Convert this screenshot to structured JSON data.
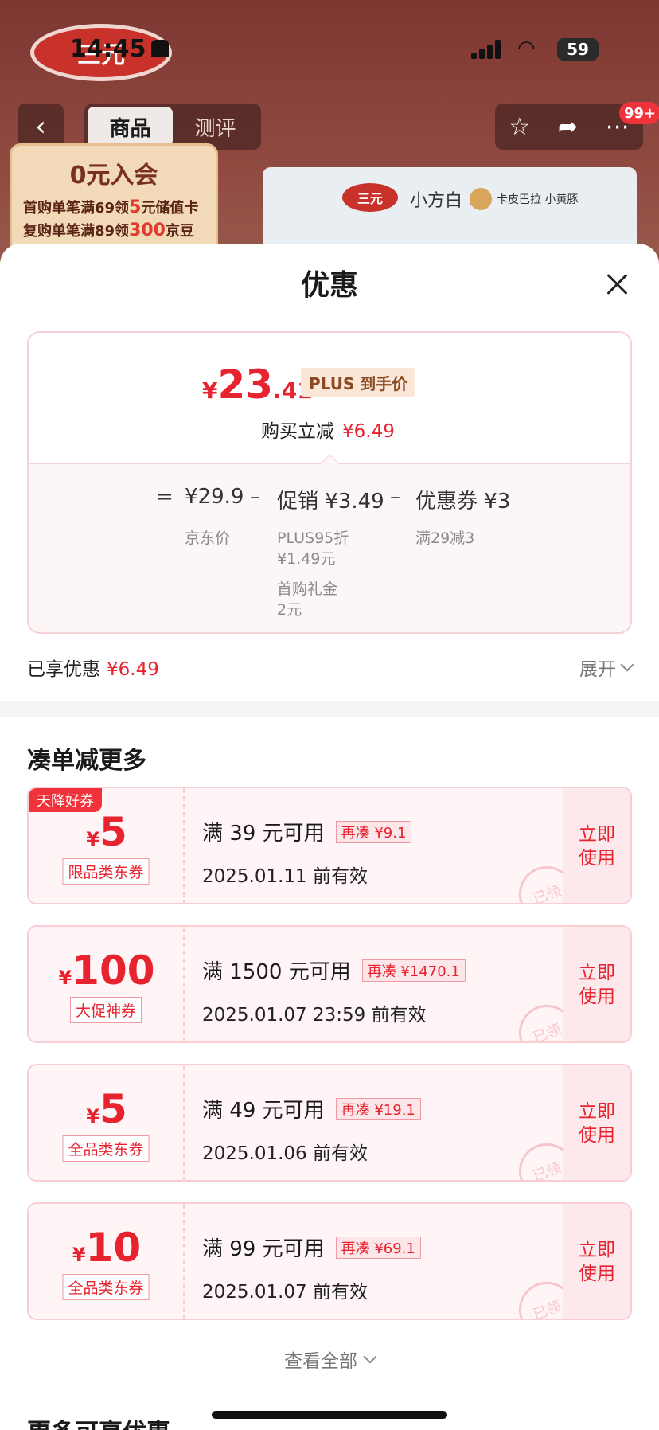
{
  "status_bar": {
    "time": "14:45",
    "battery": "59"
  },
  "nav": {
    "back": "‹",
    "tabs": [
      {
        "label": "商品"
      },
      {
        "label": "测评"
      }
    ],
    "more_badge": "99+"
  },
  "background": {
    "brand_logo": "三元",
    "promo_title": "0元入会",
    "promo_line1_a": "首购单笔满69领",
    "promo_line1_b": "5",
    "promo_line1_c": "元储值卡",
    "promo_line2_a": "复购单笔满89领",
    "promo_line2_b": "300",
    "promo_line2_c": "京豆",
    "product_logo": "三元",
    "product_name": "小方白 ×",
    "product_cobrand": "卡皮巴拉 小黄豚"
  },
  "sheet": {
    "title": "优惠",
    "price": {
      "currency": "¥",
      "integer": "23",
      "decimal": ".41",
      "plus_tag": "PLUS 到手价",
      "cut_label": "购买立减",
      "cut_value": "¥6.49"
    },
    "formula": {
      "equals": "=",
      "base": "¥29.9",
      "minus1": "–",
      "promo": "促销 ¥3.49",
      "minus2": "–",
      "coupon": "优惠券 ¥3",
      "base_label": "京东价",
      "promo_detail1": "PLUS95折",
      "promo_detail2": "¥1.49元",
      "promo_detail3": "首购礼金",
      "promo_detail4": "2元",
      "coupon_detail": "满29减3"
    },
    "enjoyed_label": "已享优惠",
    "enjoyed_value": "¥6.49",
    "expand_label": "展开",
    "section_title": "凑单减更多",
    "coupons": [
      {
        "badge": "天降好券",
        "currency": "¥",
        "amount": "5",
        "type": "限品类东券",
        "condition": "满 39 元可用",
        "gap": "再凑 ¥9.1",
        "valid": "2025.01.11 前有效",
        "action": "立即\n使用",
        "stamp": "已领"
      },
      {
        "badge": "",
        "currency": "¥",
        "amount": "100",
        "type": "大促神券",
        "condition": "满 1500 元可用",
        "gap": "再凑 ¥1470.1",
        "valid": "2025.01.07 23:59 前有效",
        "action": "立即\n使用",
        "stamp": "已领"
      },
      {
        "badge": "",
        "currency": "¥",
        "amount": "5",
        "type": "全品类东券",
        "condition": "满 49 元可用",
        "gap": "再凑 ¥19.1",
        "valid": "2025.01.06 前有效",
        "action": "立即\n使用",
        "stamp": "已领"
      },
      {
        "badge": "",
        "currency": "¥",
        "amount": "10",
        "type": "全品类东券",
        "condition": "满 99 元可用",
        "gap": "再凑 ¥69.1",
        "valid": "2025.01.07 前有效",
        "action": "立即\n使用",
        "stamp": "已领"
      }
    ],
    "view_all": "查看全部",
    "more_title": "更多可享优惠"
  }
}
